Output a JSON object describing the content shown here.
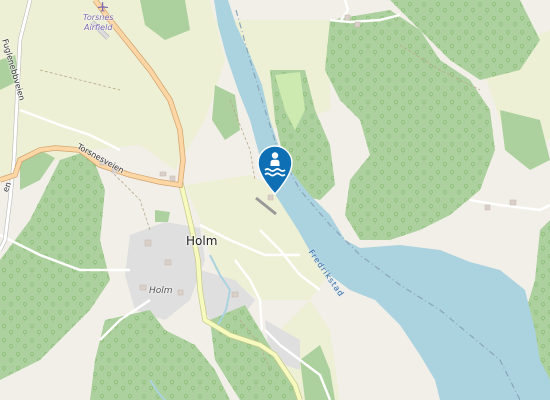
{
  "map": {
    "colors": {
      "land": "#f2efe9",
      "farmland": "#eef0d5",
      "forest": "#add19e",
      "meadow": "#cdebb0",
      "water": "#aad3df",
      "residential": "#e0dfdf",
      "road_primary": "#fcd6a4",
      "road_secondary": "#f7fabf",
      "marker": "#0e6fb4"
    },
    "places": {
      "holm": "Holm",
      "holm_locality": "Holm"
    },
    "airfield": {
      "line1": "Torsnes",
      "line2": "Airfield",
      "icon": "airplane-icon"
    },
    "roads": {
      "fuglenebbveien": "Fuglenebbveien",
      "torsnesveien": "Torsnesveien",
      "edge_road_fragment": "en"
    },
    "water": {
      "fredrikstad": "Fredrikstad"
    },
    "marker": {
      "icon": "swimming-icon",
      "type": "bathing spot"
    }
  }
}
